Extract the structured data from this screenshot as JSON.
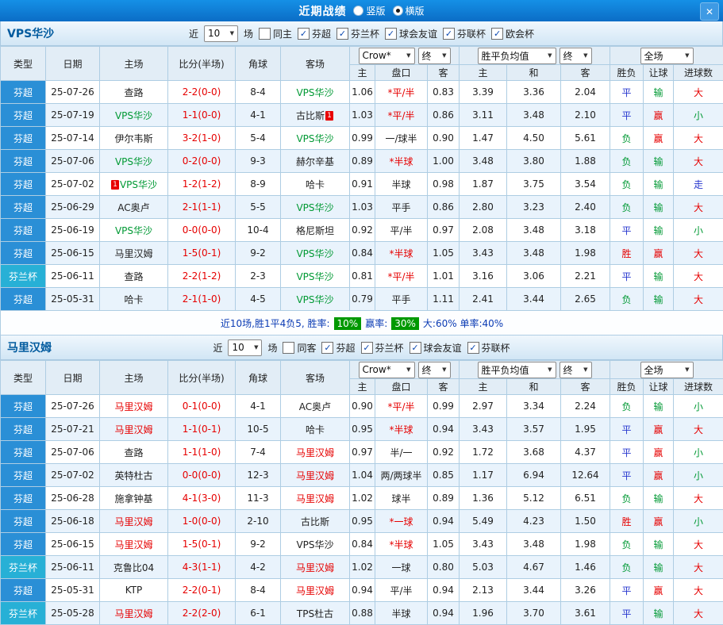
{
  "titlebar": {
    "title": "近期战绩",
    "radio_vertical": "竖版",
    "radio_horizontal": "横版",
    "close": "✕"
  },
  "labels": {
    "near": "近",
    "near_count": "10",
    "games": "场"
  },
  "selects": {
    "company": "Crow*",
    "final_a": "终",
    "avg": "胜平负均值",
    "final_b": "终",
    "scope": "全场"
  },
  "columns": [
    "类型",
    "日期",
    "主场",
    "比分(半场)",
    "角球",
    "客场",
    "主",
    "盘口",
    "客",
    "主",
    "和",
    "客",
    "胜负",
    "让球",
    "进球数"
  ],
  "colors": {
    "titlebar_blue": "#0f7fd6",
    "league_bg": "#2a8fd6",
    "cup_bg": "#27b0d6",
    "row_alt": "#e9f3fc",
    "red": "#e60000",
    "green": "#019934",
    "blue": "#2737cf",
    "chip_green": "#009900",
    "team_name_blue": "#005a9e"
  },
  "value_colors": {
    "胜": "red",
    "平": "blue",
    "负": "green",
    "赢": "red",
    "输": "green",
    "大": "red",
    "小": "green",
    "走": "blue"
  },
  "type_styles": {
    "芬超": "type-league",
    "芬兰杯": "type-cup"
  },
  "sections": [
    {
      "team": "VPS华沙",
      "filters": [
        {
          "label": "同主",
          "checked": false
        },
        {
          "label": "芬超",
          "checked": true
        },
        {
          "label": "芬兰杯",
          "checked": true
        },
        {
          "label": "球会友谊",
          "checked": true
        },
        {
          "label": "芬联杯",
          "checked": true
        },
        {
          "label": "欧会杯",
          "checked": true
        }
      ],
      "rows": [
        {
          "type": "芬超",
          "date": "25-07-26",
          "home": {
            "t": "查路"
          },
          "score": "2-2(0-0)",
          "corner": "8-4",
          "away": {
            "t": "VPS华沙",
            "hl": "green"
          },
          "o": [
            "1.06",
            "*平/半",
            "0.83"
          ],
          "avg": [
            "3.39",
            "3.36",
            "2.04"
          ],
          "r": [
            "平",
            "输",
            "大"
          ]
        },
        {
          "type": "芬超",
          "date": "25-07-19",
          "home": {
            "t": "VPS华沙",
            "hl": "green"
          },
          "score": "1-1(0-0)",
          "corner": "4-1",
          "away": {
            "t": "古比斯",
            "card": "1",
            "cardpos": "after"
          },
          "o": [
            "1.03",
            "*平/半",
            "0.86"
          ],
          "avg": [
            "3.11",
            "3.48",
            "2.10"
          ],
          "r": [
            "平",
            "赢",
            "小"
          ]
        },
        {
          "type": "芬超",
          "date": "25-07-14",
          "home": {
            "t": "伊尔韦斯"
          },
          "score": "3-2(1-0)",
          "corner": "5-4",
          "away": {
            "t": "VPS华沙",
            "hl": "green"
          },
          "o": [
            "0.99",
            "一/球半",
            "0.90"
          ],
          "avg": [
            "1.47",
            "4.50",
            "5.61"
          ],
          "r": [
            "负",
            "赢",
            "大"
          ]
        },
        {
          "type": "芬超",
          "date": "25-07-06",
          "home": {
            "t": "VPS华沙",
            "hl": "green"
          },
          "score": "0-2(0-0)",
          "corner": "9-3",
          "away": {
            "t": "赫尔辛基"
          },
          "o": [
            "0.89",
            "*半球",
            "1.00"
          ],
          "avg": [
            "3.48",
            "3.80",
            "1.88"
          ],
          "r": [
            "负",
            "输",
            "大"
          ]
        },
        {
          "type": "芬超",
          "date": "25-07-02",
          "home": {
            "t": "VPS华沙",
            "hl": "green",
            "card": "1",
            "cardpos": "before"
          },
          "score": "1-2(1-2)",
          "corner": "8-9",
          "away": {
            "t": "哈卡"
          },
          "o": [
            "0.91",
            "半球",
            "0.98"
          ],
          "avg": [
            "1.87",
            "3.75",
            "3.54"
          ],
          "r": [
            "负",
            "输",
            "走"
          ]
        },
        {
          "type": "芬超",
          "date": "25-06-29",
          "home": {
            "t": "AC奥卢"
          },
          "score": "2-1(1-1)",
          "corner": "5-5",
          "away": {
            "t": "VPS华沙",
            "hl": "green"
          },
          "o": [
            "1.03",
            "平手",
            "0.86"
          ],
          "avg": [
            "2.80",
            "3.23",
            "2.40"
          ],
          "r": [
            "负",
            "输",
            "大"
          ]
        },
        {
          "type": "芬超",
          "date": "25-06-19",
          "home": {
            "t": "VPS华沙",
            "hl": "green"
          },
          "score": "0-0(0-0)",
          "corner": "10-4",
          "away": {
            "t": "格尼斯坦"
          },
          "o": [
            "0.92",
            "平/半",
            "0.97"
          ],
          "avg": [
            "2.08",
            "3.48",
            "3.18"
          ],
          "r": [
            "平",
            "输",
            "小"
          ]
        },
        {
          "type": "芬超",
          "date": "25-06-15",
          "home": {
            "t": "马里汉姆"
          },
          "score": "1-5(0-1)",
          "corner": "9-2",
          "away": {
            "t": "VPS华沙",
            "hl": "green"
          },
          "o": [
            "0.84",
            "*半球",
            "1.05"
          ],
          "avg": [
            "3.43",
            "3.48",
            "1.98"
          ],
          "r": [
            "胜",
            "赢",
            "大"
          ]
        },
        {
          "type": "芬兰杯",
          "date": "25-06-11",
          "home": {
            "t": "查路"
          },
          "score": "2-2(1-2)",
          "corner": "2-3",
          "away": {
            "t": "VPS华沙",
            "hl": "green"
          },
          "o": [
            "0.81",
            "*平/半",
            "1.01"
          ],
          "avg": [
            "3.16",
            "3.06",
            "2.21"
          ],
          "r": [
            "平",
            "输",
            "大"
          ]
        },
        {
          "type": "芬超",
          "date": "25-05-31",
          "home": {
            "t": "哈卡"
          },
          "score": "2-1(1-0)",
          "corner": "4-5",
          "away": {
            "t": "VPS华沙",
            "hl": "green"
          },
          "o": [
            "0.79",
            "平手",
            "1.11"
          ],
          "avg": [
            "2.41",
            "3.44",
            "2.65"
          ],
          "r": [
            "负",
            "输",
            "大"
          ]
        }
      ],
      "summary": {
        "lead": "近10场,胜1平4负5, 胜率:",
        "win_rate": "10%",
        "mid": "赢率:",
        "let_rate": "30%",
        "tail": "大:60% 单率:40%"
      }
    },
    {
      "team": "马里汉姆",
      "filters": [
        {
          "label": "同客",
          "checked": false
        },
        {
          "label": "芬超",
          "checked": true
        },
        {
          "label": "芬兰杯",
          "checked": true
        },
        {
          "label": "球会友谊",
          "checked": true
        },
        {
          "label": "芬联杯",
          "checked": true
        }
      ],
      "rows": [
        {
          "type": "芬超",
          "date": "25-07-26",
          "home": {
            "t": "马里汉姆",
            "hl": "red"
          },
          "score": "0-1(0-0)",
          "corner": "4-1",
          "away": {
            "t": "AC奥卢"
          },
          "o": [
            "0.90",
            "*平/半",
            "0.99"
          ],
          "avg": [
            "2.97",
            "3.34",
            "2.24"
          ],
          "r": [
            "负",
            "输",
            "小"
          ]
        },
        {
          "type": "芬超",
          "date": "25-07-21",
          "home": {
            "t": "马里汉姆",
            "hl": "red"
          },
          "score": "1-1(0-1)",
          "corner": "10-5",
          "away": {
            "t": "哈卡"
          },
          "o": [
            "0.95",
            "*半球",
            "0.94"
          ],
          "avg": [
            "3.43",
            "3.57",
            "1.95"
          ],
          "r": [
            "平",
            "赢",
            "大"
          ]
        },
        {
          "type": "芬超",
          "date": "25-07-06",
          "home": {
            "t": "查路"
          },
          "score": "1-1(1-0)",
          "corner": "7-4",
          "away": {
            "t": "马里汉姆",
            "hl": "red"
          },
          "o": [
            "0.97",
            "半/一",
            "0.92"
          ],
          "avg": [
            "1.72",
            "3.68",
            "4.37"
          ],
          "r": [
            "平",
            "赢",
            "小"
          ]
        },
        {
          "type": "芬超",
          "date": "25-07-02",
          "home": {
            "t": "英特杜古"
          },
          "score": "0-0(0-0)",
          "corner": "12-3",
          "away": {
            "t": "马里汉姆",
            "hl": "red"
          },
          "o": [
            "1.04",
            "两/两球半",
            "0.85"
          ],
          "avg": [
            "1.17",
            "6.94",
            "12.64"
          ],
          "r": [
            "平",
            "赢",
            "小"
          ]
        },
        {
          "type": "芬超",
          "date": "25-06-28",
          "home": {
            "t": "施拿钟基"
          },
          "score": "4-1(3-0)",
          "corner": "11-3",
          "away": {
            "t": "马里汉姆",
            "hl": "red"
          },
          "o": [
            "1.02",
            "球半",
            "0.89"
          ],
          "avg": [
            "1.36",
            "5.12",
            "6.51"
          ],
          "r": [
            "负",
            "输",
            "大"
          ]
        },
        {
          "type": "芬超",
          "date": "25-06-18",
          "home": {
            "t": "马里汉姆",
            "hl": "red"
          },
          "score": "1-0(0-0)",
          "corner": "2-10",
          "away": {
            "t": "古比斯"
          },
          "o": [
            "0.95",
            "*一球",
            "0.94"
          ],
          "avg": [
            "5.49",
            "4.23",
            "1.50"
          ],
          "r": [
            "胜",
            "赢",
            "小"
          ]
        },
        {
          "type": "芬超",
          "date": "25-06-15",
          "home": {
            "t": "马里汉姆",
            "hl": "red"
          },
          "score": "1-5(0-1)",
          "corner": "9-2",
          "away": {
            "t": "VPS华沙"
          },
          "o": [
            "0.84",
            "*半球",
            "1.05"
          ],
          "avg": [
            "3.43",
            "3.48",
            "1.98"
          ],
          "r": [
            "负",
            "输",
            "大"
          ]
        },
        {
          "type": "芬兰杯",
          "date": "25-06-11",
          "home": {
            "t": "克鲁比04"
          },
          "score": "4-3(1-1)",
          "corner": "4-2",
          "away": {
            "t": "马里汉姆",
            "hl": "red"
          },
          "o": [
            "1.02",
            "一球",
            "0.80"
          ],
          "avg": [
            "5.03",
            "4.67",
            "1.46"
          ],
          "r": [
            "负",
            "输",
            "大"
          ]
        },
        {
          "type": "芬超",
          "date": "25-05-31",
          "home": {
            "t": "KTP"
          },
          "score": "2-2(0-1)",
          "corner": "8-4",
          "away": {
            "t": "马里汉姆",
            "hl": "red"
          },
          "o": [
            "0.94",
            "平/半",
            "0.94"
          ],
          "avg": [
            "2.13",
            "3.44",
            "3.26"
          ],
          "r": [
            "平",
            "赢",
            "大"
          ]
        },
        {
          "type": "芬兰杯",
          "date": "25-05-28",
          "home": {
            "t": "马里汉姆",
            "hl": "red"
          },
          "score": "2-2(2-0)",
          "corner": "6-1",
          "away": {
            "t": "TPS杜古"
          },
          "o": [
            "0.88",
            "半球",
            "0.94"
          ],
          "avg": [
            "1.96",
            "3.70",
            "3.61"
          ],
          "r": [
            "平",
            "输",
            "大"
          ]
        }
      ],
      "summary": null
    }
  ]
}
